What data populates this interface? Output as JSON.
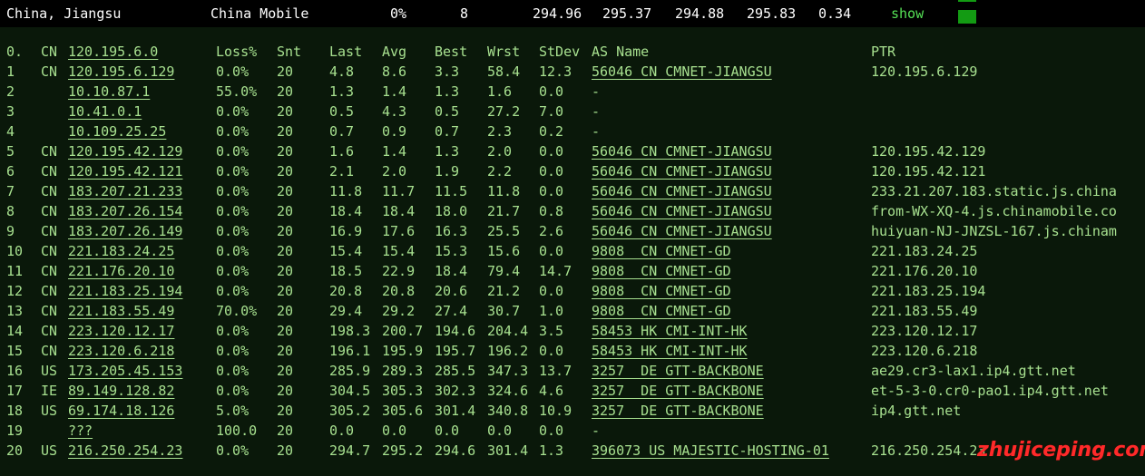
{
  "summary": {
    "location": "China, Jiangsu",
    "isp": "China Mobile",
    "loss": "0%",
    "sent": "8",
    "last": "294.96",
    "avg": "295.37",
    "best": "294.88",
    "worst": "295.83",
    "stdev": "0.34",
    "show_label": "show"
  },
  "columns": [
    "0.",
    "CN",
    "120.195.6.0",
    "Loss%",
    "Snt",
    "Last",
    "Avg",
    "Best",
    "Wrst",
    "StDev",
    "AS Name",
    "PTR"
  ],
  "rows": [
    {
      "hop": "1",
      "cc": "CN",
      "ip": "120.195.6.129",
      "loss": "0.0%",
      "snt": "20",
      "last": "4.8",
      "avg": "8.6",
      "best": "3.3",
      "wrst": "58.4",
      "stdev": "12.3",
      "as": "56046 CN CMNET-JIANGSU",
      "ptr": "120.195.6.129"
    },
    {
      "hop": "2",
      "cc": "",
      "ip": "10.10.87.1",
      "loss": "55.0%",
      "snt": "20",
      "last": "1.3",
      "avg": "1.4",
      "best": "1.3",
      "wrst": "1.6",
      "stdev": "0.0",
      "as": "-",
      "ptr": ""
    },
    {
      "hop": "3",
      "cc": "",
      "ip": "10.41.0.1",
      "loss": "0.0%",
      "snt": "20",
      "last": "0.5",
      "avg": "4.3",
      "best": "0.5",
      "wrst": "27.2",
      "stdev": "7.0",
      "as": "-",
      "ptr": ""
    },
    {
      "hop": "4",
      "cc": "",
      "ip": "10.109.25.25",
      "loss": "0.0%",
      "snt": "20",
      "last": "0.7",
      "avg": "0.9",
      "best": "0.7",
      "wrst": "2.3",
      "stdev": "0.2",
      "as": "-",
      "ptr": ""
    },
    {
      "hop": "5",
      "cc": "CN",
      "ip": "120.195.42.129",
      "loss": "0.0%",
      "snt": "20",
      "last": "1.6",
      "avg": "1.4",
      "best": "1.3",
      "wrst": "2.0",
      "stdev": "0.0",
      "as": "56046 CN CMNET-JIANGSU",
      "ptr": "120.195.42.129"
    },
    {
      "hop": "6",
      "cc": "CN",
      "ip": "120.195.42.121",
      "loss": "0.0%",
      "snt": "20",
      "last": "2.1",
      "avg": "2.0",
      "best": "1.9",
      "wrst": "2.2",
      "stdev": "0.0",
      "as": "56046 CN CMNET-JIANGSU",
      "ptr": "120.195.42.121"
    },
    {
      "hop": "7",
      "cc": "CN",
      "ip": "183.207.21.233",
      "loss": "0.0%",
      "snt": "20",
      "last": "11.8",
      "avg": "11.7",
      "best": "11.5",
      "wrst": "11.8",
      "stdev": "0.0",
      "as": "56046 CN CMNET-JIANGSU",
      "ptr": "233.21.207.183.static.js.china"
    },
    {
      "hop": "8",
      "cc": "CN",
      "ip": "183.207.26.154",
      "loss": "0.0%",
      "snt": "20",
      "last": "18.4",
      "avg": "18.4",
      "best": "18.0",
      "wrst": "21.7",
      "stdev": "0.8",
      "as": "56046 CN CMNET-JIANGSU",
      "ptr": "from-WX-XQ-4.js.chinamobile.co"
    },
    {
      "hop": "9",
      "cc": "CN",
      "ip": "183.207.26.149",
      "loss": "0.0%",
      "snt": "20",
      "last": "16.9",
      "avg": "17.6",
      "best": "16.3",
      "wrst": "25.5",
      "stdev": "2.6",
      "as": "56046 CN CMNET-JIANGSU",
      "ptr": "huiyuan-NJ-JNZSL-167.js.chinam"
    },
    {
      "hop": "10",
      "cc": "CN",
      "ip": "221.183.24.25",
      "loss": "0.0%",
      "snt": "20",
      "last": "15.4",
      "avg": "15.4",
      "best": "15.3",
      "wrst": "15.6",
      "stdev": "0.0",
      "as": "9808  CN CMNET-GD",
      "ptr": "221.183.24.25"
    },
    {
      "hop": "11",
      "cc": "CN",
      "ip": "221.176.20.10",
      "loss": "0.0%",
      "snt": "20",
      "last": "18.5",
      "avg": "22.9",
      "best": "18.4",
      "wrst": "79.4",
      "stdev": "14.7",
      "as": "9808  CN CMNET-GD",
      "ptr": "221.176.20.10"
    },
    {
      "hop": "12",
      "cc": "CN",
      "ip": "221.183.25.194",
      "loss": "0.0%",
      "snt": "20",
      "last": "20.8",
      "avg": "20.8",
      "best": "20.6",
      "wrst": "21.2",
      "stdev": "0.0",
      "as": "9808  CN CMNET-GD",
      "ptr": "221.183.25.194"
    },
    {
      "hop": "13",
      "cc": "CN",
      "ip": "221.183.55.49",
      "loss": "70.0%",
      "snt": "20",
      "last": "29.4",
      "avg": "29.2",
      "best": "27.4",
      "wrst": "30.7",
      "stdev": "1.0",
      "as": "9808  CN CMNET-GD",
      "ptr": "221.183.55.49"
    },
    {
      "hop": "14",
      "cc": "CN",
      "ip": "223.120.12.17",
      "loss": "0.0%",
      "snt": "20",
      "last": "198.3",
      "avg": "200.7",
      "best": "194.6",
      "wrst": "204.4",
      "stdev": "3.5",
      "as": "58453 HK CMI-INT-HK",
      "ptr": "223.120.12.17"
    },
    {
      "hop": "15",
      "cc": "CN",
      "ip": "223.120.6.218",
      "loss": "0.0%",
      "snt": "20",
      "last": "196.1",
      "avg": "195.9",
      "best": "195.7",
      "wrst": "196.2",
      "stdev": "0.0",
      "as": "58453 HK CMI-INT-HK",
      "ptr": "223.120.6.218"
    },
    {
      "hop": "16",
      "cc": "US",
      "ip": "173.205.45.153",
      "loss": "0.0%",
      "snt": "20",
      "last": "285.9",
      "avg": "289.3",
      "best": "285.5",
      "wrst": "347.3",
      "stdev": "13.7",
      "as": "3257  DE GTT-BACKBONE",
      "ptr": "ae29.cr3-lax1.ip4.gtt.net"
    },
    {
      "hop": "17",
      "cc": "IE",
      "ip": "89.149.128.82",
      "loss": "0.0%",
      "snt": "20",
      "last": "304.5",
      "avg": "305.3",
      "best": "302.3",
      "wrst": "324.6",
      "stdev": "4.6",
      "as": "3257  DE GTT-BACKBONE",
      "ptr": "et-5-3-0.cr0-pao1.ip4.gtt.net"
    },
    {
      "hop": "18",
      "cc": "US",
      "ip": "69.174.18.126",
      "loss": "5.0%",
      "snt": "20",
      "last": "305.2",
      "avg": "305.6",
      "best": "301.4",
      "wrst": "340.8",
      "stdev": "10.9",
      "as": "3257  DE GTT-BACKBONE",
      "ptr": "ip4.gtt.net"
    },
    {
      "hop": "19",
      "cc": "",
      "ip": "???",
      "loss": "100.0",
      "snt": "20",
      "last": "0.0",
      "avg": "0.0",
      "best": "0.0",
      "wrst": "0.0",
      "stdev": "0.0",
      "as": "-",
      "ptr": ""
    },
    {
      "hop": "20",
      "cc": "US",
      "ip": "216.250.254.23",
      "loss": "0.0%",
      "snt": "20",
      "last": "294.7",
      "avg": "295.2",
      "best": "294.6",
      "wrst": "301.4",
      "stdev": "1.3",
      "as": "396073 US MAJESTIC-HOSTING-01",
      "ptr": "216.250.254.23"
    }
  ],
  "watermark": "zhujiceping.com",
  "colors": {
    "background": "#0a180a",
    "text": "#a7e08f",
    "summary_text": "#ffffff",
    "show_link": "#55e055",
    "indicator": "#139b13",
    "watermark": "#ff2a2a"
  }
}
